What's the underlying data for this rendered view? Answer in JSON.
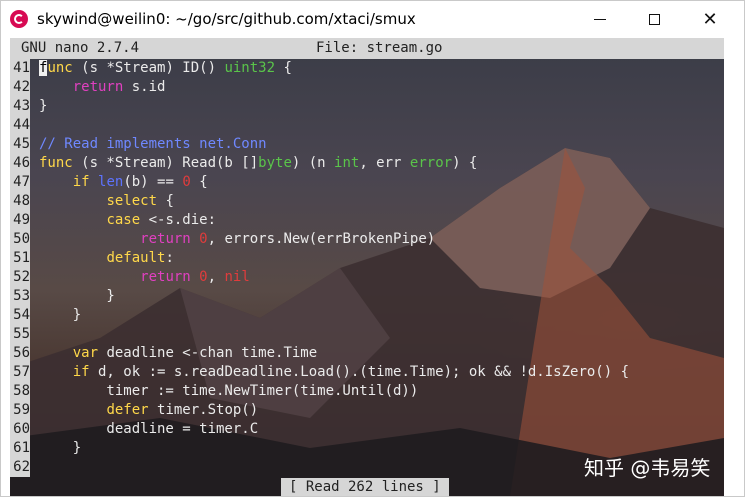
{
  "window": {
    "title": "skywind@weilin0: ~/go/src/github.com/xtaci/smux"
  },
  "nano": {
    "version_label": "GNU nano 2.7.4",
    "file_label": "File: stream.go",
    "message": "[ Read 262 lines ]"
  },
  "watermark": "知乎 @韦易笑",
  "lines": [
    {
      "num": "41",
      "tokens": [
        [
          "kw",
          "func"
        ],
        [
          "pl",
          " (s *Stream) ID() "
        ],
        [
          "type",
          "uint32"
        ],
        [
          "pl",
          " {"
        ]
      ]
    },
    {
      "num": "42",
      "tokens": [
        [
          "pl",
          "    "
        ],
        [
          "ret",
          "return"
        ],
        [
          "pl",
          " s.id"
        ]
      ]
    },
    {
      "num": "43",
      "tokens": [
        [
          "pl",
          "}"
        ]
      ]
    },
    {
      "num": "44",
      "tokens": []
    },
    {
      "num": "45",
      "tokens": [
        [
          "cm",
          "// Read implements net.Conn"
        ]
      ]
    },
    {
      "num": "46",
      "tokens": [
        [
          "kw",
          "func"
        ],
        [
          "pl",
          " (s *Stream) Read(b []"
        ],
        [
          "type",
          "byte"
        ],
        [
          "pl",
          ") (n "
        ],
        [
          "type",
          "int"
        ],
        [
          "pl",
          ", err "
        ],
        [
          "type",
          "error"
        ],
        [
          "pl",
          ") {"
        ]
      ]
    },
    {
      "num": "47",
      "tokens": [
        [
          "pl",
          "    "
        ],
        [
          "kw",
          "if"
        ],
        [
          "pl",
          " "
        ],
        [
          "bi",
          "len"
        ],
        [
          "pl",
          "(b) == "
        ],
        [
          "red",
          "0"
        ],
        [
          "pl",
          " {"
        ]
      ]
    },
    {
      "num": "48",
      "tokens": [
        [
          "pl",
          "        "
        ],
        [
          "kw",
          "select"
        ],
        [
          "pl",
          " {"
        ]
      ]
    },
    {
      "num": "49",
      "tokens": [
        [
          "pl",
          "        "
        ],
        [
          "kw",
          "case"
        ],
        [
          "pl",
          " <-s.die:"
        ]
      ]
    },
    {
      "num": "50",
      "tokens": [
        [
          "pl",
          "            "
        ],
        [
          "ret",
          "return"
        ],
        [
          "pl",
          " "
        ],
        [
          "red",
          "0"
        ],
        [
          "pl",
          ", errors.New(errBrokenPipe)"
        ]
      ]
    },
    {
      "num": "51",
      "tokens": [
        [
          "pl",
          "        "
        ],
        [
          "kw",
          "default"
        ],
        [
          "pl",
          ":"
        ]
      ]
    },
    {
      "num": "52",
      "tokens": [
        [
          "pl",
          "            "
        ],
        [
          "ret",
          "return"
        ],
        [
          "pl",
          " "
        ],
        [
          "red",
          "0"
        ],
        [
          "pl",
          ", "
        ],
        [
          "red",
          "nil"
        ]
      ]
    },
    {
      "num": "53",
      "tokens": [
        [
          "pl",
          "        }"
        ]
      ]
    },
    {
      "num": "54",
      "tokens": [
        [
          "pl",
          "    }"
        ]
      ]
    },
    {
      "num": "55",
      "tokens": []
    },
    {
      "num": "56",
      "tokens": [
        [
          "pl",
          "    "
        ],
        [
          "kw",
          "var"
        ],
        [
          "pl",
          " deadline <-chan time.Time"
        ]
      ]
    },
    {
      "num": "57",
      "tokens": [
        [
          "pl",
          "    "
        ],
        [
          "kw",
          "if"
        ],
        [
          "pl",
          " d, ok := s.readDeadline.Load().(time.Time); ok && !d.IsZero() {"
        ]
      ]
    },
    {
      "num": "58",
      "tokens": [
        [
          "pl",
          "        timer := time.NewTimer(time.Until(d))"
        ]
      ]
    },
    {
      "num": "59",
      "tokens": [
        [
          "pl",
          "        "
        ],
        [
          "kw",
          "defer"
        ],
        [
          "pl",
          " timer.Stop()"
        ]
      ]
    },
    {
      "num": "60",
      "tokens": [
        [
          "pl",
          "        deadline = timer.C"
        ]
      ]
    },
    {
      "num": "61",
      "tokens": [
        [
          "pl",
          "    }"
        ]
      ]
    },
    {
      "num": "62",
      "tokens": []
    }
  ]
}
